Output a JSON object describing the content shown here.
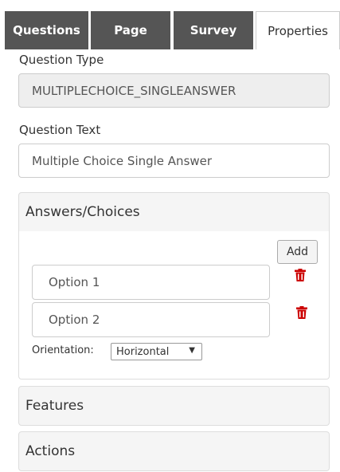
{
  "tabs": [
    {
      "label": "Questions"
    },
    {
      "label": "Page"
    },
    {
      "label": "Survey"
    },
    {
      "label": "Properties"
    }
  ],
  "question_type": {
    "label": "Question Type",
    "value": "MULTIPLECHOICE_SINGLEANSWER"
  },
  "question_text": {
    "label": "Question Text",
    "value": "Multiple Choice Single Answer"
  },
  "answers_panel": {
    "title": "Answers/Choices",
    "add_label": "Add",
    "options": [
      {
        "value": "Option 1"
      },
      {
        "value": "Option 2"
      }
    ],
    "orientation_label": "Orientation:",
    "orientation_value": "Horizontal"
  },
  "features_panel": {
    "title": "Features"
  },
  "actions_panel": {
    "title": "Actions"
  },
  "colors": {
    "tab_dark": "#555555",
    "delete_icon": "#cc0000",
    "panel_header_bg": "#f5f5f5",
    "readonly_bg": "#eeeeee"
  },
  "icons": {
    "delete": "trash-icon",
    "dropdown": "dropdown-arrow-icon"
  }
}
